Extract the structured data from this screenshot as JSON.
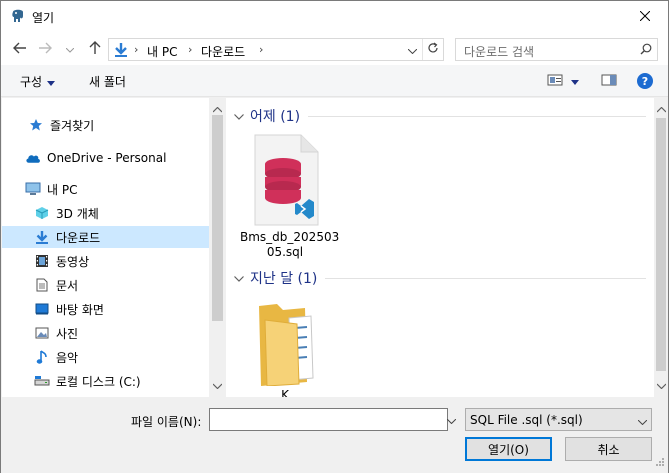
{
  "window": {
    "title": "열기"
  },
  "address": {
    "crumbs": [
      "내 PC",
      "다운로드"
    ]
  },
  "search": {
    "placeholder": "다운로드 검색"
  },
  "toolbar": {
    "organize": "구성",
    "new_folder": "새 폴더",
    "help": "?"
  },
  "sidebar": {
    "items": [
      {
        "label": "즐겨찾기",
        "icon": "star-icon"
      },
      {
        "label": "OneDrive - Personal",
        "icon": "cloud-icon"
      },
      {
        "label": "내 PC",
        "icon": "pc-icon"
      },
      {
        "label": "3D 개체",
        "icon": "cube-icon"
      },
      {
        "label": "다운로드",
        "icon": "download-icon",
        "selected": true
      },
      {
        "label": "동영상",
        "icon": "film-icon"
      },
      {
        "label": "문서",
        "icon": "document-icon"
      },
      {
        "label": "바탕 화면",
        "icon": "desktop-icon"
      },
      {
        "label": "사진",
        "icon": "picture-icon"
      },
      {
        "label": "음악",
        "icon": "music-icon"
      },
      {
        "label": "로컬 디스크 (C:)",
        "icon": "drive-icon"
      }
    ]
  },
  "groups": [
    {
      "label": "어제 (1)",
      "files": [
        {
          "name_line1": "Bms_db_202503",
          "name_line2": "05.sql",
          "icon": "sql-file-icon"
        }
      ]
    },
    {
      "label": "지난 달 (1)",
      "files": [
        {
          "name_line1": "K",
          "icon": "folder-icon"
        }
      ]
    }
  ],
  "bottom": {
    "filename_label": "파일 이름(N):",
    "filename_value": "",
    "filetype_value": "SQL File .sql (*.sql)",
    "open_label": "열기(O)",
    "cancel_label": "취소"
  },
  "colors": {
    "accent": "#0078d7",
    "group_header": "#1e3287",
    "selected": "#cce8ff"
  }
}
